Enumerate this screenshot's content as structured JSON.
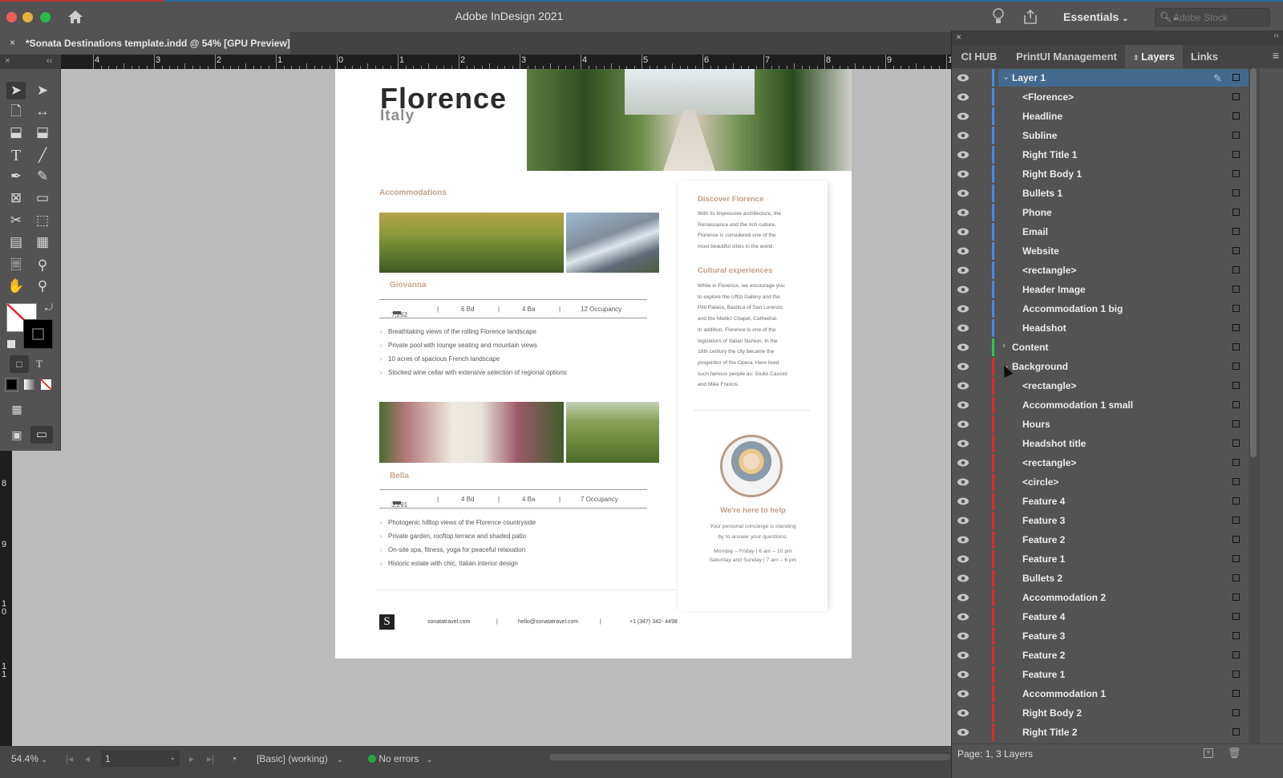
{
  "app": {
    "title": "Adobe InDesign 2021",
    "workspace": "Essentials",
    "search_placeholder": "Adobe Stock"
  },
  "document_tab": {
    "title": "*Sonata Destinations template.indd @ 54% [GPU Preview]",
    "close": "×"
  },
  "ruler": {
    "horizontal": [
      "4",
      "3",
      "2",
      "1",
      "0",
      "1",
      "2",
      "3",
      "4",
      "5",
      "6",
      "7",
      "8",
      "9",
      "1"
    ],
    "vertical": [
      "8",
      "9",
      "1\n0",
      "1\n1"
    ]
  },
  "toolbox": {
    "tools": [
      "selection-tool",
      "direct-selection-tool",
      "page-tool",
      "gap-tool",
      "content-collector-tool",
      "content-placer-tool",
      "type-tool",
      "line-tool",
      "pen-tool",
      "pencil-tool",
      "rectangle-frame-tool",
      "rectangle-tool",
      "scissors-tool",
      "free-transform-tool",
      "gradient-swatch-tool",
      "gradient-feather-tool",
      "note-tool",
      "eyedropper-tool",
      "hand-tool",
      "zoom-tool"
    ]
  },
  "page": {
    "headline": "Florence",
    "subline": "Italy",
    "accommodations_title": "Accommodations",
    "accommodations": [
      {
        "name": "Giovanna",
        "sqft": "7,262",
        "beds": "6 Bd",
        "baths": "4 Ba",
        "occupancy": "12 Occupancy",
        "bullets": [
          "Breathtaking views of the rolling Florence landscape",
          "Private pool with lounge seating and mountain views",
          "10 acres of spacious French landscape",
          "Stocked wine cellar with extensive selection of regional options"
        ]
      },
      {
        "name": "Bella",
        "sqft": "3,291",
        "beds": "4 Bd",
        "baths": "4 Ba",
        "occupancy": "7 Occupancy",
        "bullets": [
          "Photogenic hilltop views of the Florence countryside",
          "Private garden, rooftop terrace and shaded patio",
          "On-site spa, fitness, yoga for peaceful relaxation",
          "Historic estate with chic, Italian interior design"
        ]
      }
    ],
    "separator": "|",
    "right": {
      "title1": "Discover Florence",
      "body1": [
        "With its impressive architecture, the",
        "Renaissance and the rich culture,",
        "Florence is considered one of the",
        "most beautiful cities in the world."
      ],
      "title2": "Cultural experiences",
      "body2": [
        "While in Florence, we encourage you",
        "to explore the Uffizi Gallery and the",
        "Pitti Palace, Basilica of San Lorenzo",
        "and the Medici Chapel, Cathedral.",
        "In addition, Florence is one of the",
        "legislators of Italian fashion. In the",
        "16th century the city became the",
        "progenitor of the Opera. Here lived",
        "such famous people as: Giulio Caccini",
        "and Mike Francis."
      ],
      "help_title": "We're here to help",
      "help_body": [
        "Your personal concierge is standing",
        "by to answer your questions."
      ],
      "hours": [
        "Monday – Friday  |  6 am – 10 pm",
        "Saturday and Sunday  |  7 am – 6 pm"
      ]
    },
    "footer": {
      "logo": "S",
      "website": "sonatatravel.com",
      "email": "hello@sonatatravel.com",
      "phone": "+1 (347) 342- 4498"
    }
  },
  "panel": {
    "tabs": [
      "CI HUB",
      "PrintUI Management",
      "Layers",
      "Links"
    ],
    "active_tab": "Layers",
    "layers": [
      {
        "name": "Layer 1",
        "level": 0,
        "color": "#3d8ef0",
        "expanded": true,
        "selected": true
      },
      {
        "name": "<Florence>",
        "level": 1,
        "color": "#3d8ef0"
      },
      {
        "name": "Headline",
        "level": 1,
        "color": "#3d8ef0"
      },
      {
        "name": "Subline",
        "level": 1,
        "color": "#3d8ef0"
      },
      {
        "name": "Right Title 1",
        "level": 1,
        "color": "#3d8ef0"
      },
      {
        "name": "Right Body 1",
        "level": 1,
        "color": "#3d8ef0"
      },
      {
        "name": "Bullets 1",
        "level": 1,
        "color": "#3d8ef0"
      },
      {
        "name": "Phone",
        "level": 1,
        "color": "#3d8ef0"
      },
      {
        "name": "Email",
        "level": 1,
        "color": "#3d8ef0"
      },
      {
        "name": "Website",
        "level": 1,
        "color": "#3d8ef0"
      },
      {
        "name": "<rectangle>",
        "level": 1,
        "color": "#3d8ef0"
      },
      {
        "name": "Header Image",
        "level": 1,
        "color": "#3d8ef0"
      },
      {
        "name": "Accommodation 1 big",
        "level": 1,
        "color": "#3d8ef0"
      },
      {
        "name": "Headshot",
        "level": 1,
        "color": "#3d8ef0"
      },
      {
        "name": "Content",
        "level": 0,
        "color": "#27c94a",
        "expanded": false
      },
      {
        "name": "Background",
        "level": 0,
        "color": "#e8262a",
        "expanded": true
      },
      {
        "name": "<rectangle>",
        "level": 1,
        "color": "#e8262a"
      },
      {
        "name": "Accommodation 1 small",
        "level": 1,
        "color": "#e8262a"
      },
      {
        "name": "Hours",
        "level": 1,
        "color": "#e8262a"
      },
      {
        "name": "Headshot title",
        "level": 1,
        "color": "#e8262a"
      },
      {
        "name": "<rectangle>",
        "level": 1,
        "color": "#e8262a"
      },
      {
        "name": "<circle>",
        "level": 1,
        "color": "#e8262a"
      },
      {
        "name": "Feature 4",
        "level": 1,
        "color": "#e8262a"
      },
      {
        "name": "Feature 3",
        "level": 1,
        "color": "#e8262a"
      },
      {
        "name": "Feature 2",
        "level": 1,
        "color": "#e8262a"
      },
      {
        "name": "Feature 1",
        "level": 1,
        "color": "#e8262a"
      },
      {
        "name": "Bullets 2",
        "level": 1,
        "color": "#e8262a"
      },
      {
        "name": "Accommodation 2",
        "level": 1,
        "color": "#e8262a"
      },
      {
        "name": "Feature 4",
        "level": 1,
        "color": "#e8262a"
      },
      {
        "name": "Feature 3",
        "level": 1,
        "color": "#e8262a"
      },
      {
        "name": "Feature 2",
        "level": 1,
        "color": "#e8262a"
      },
      {
        "name": "Feature 1",
        "level": 1,
        "color": "#e8262a"
      },
      {
        "name": "Accommodation 1",
        "level": 1,
        "color": "#e8262a"
      },
      {
        "name": "Right Body 2",
        "level": 1,
        "color": "#e8262a"
      },
      {
        "name": "Right Title 2",
        "level": 1,
        "color": "#e8262a"
      }
    ],
    "footer": "Page: 1, 3 Layers"
  },
  "statusbar": {
    "zoom": "54.4%",
    "page": "1",
    "preflight_profile": "[Basic] (working)",
    "errors": "No errors",
    "status_color": "#27a844"
  }
}
